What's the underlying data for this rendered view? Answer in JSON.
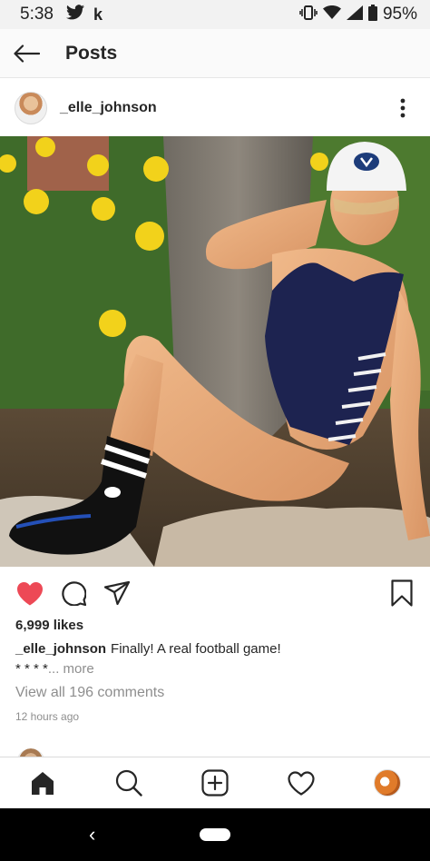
{
  "status_bar": {
    "time": "5:38",
    "left_icons": [
      "twitter-icon",
      "k-icon"
    ],
    "k_label": "k",
    "right_icons": [
      "vibrate-icon",
      "wifi-icon",
      "signal-icon",
      "battery-icon"
    ],
    "battery": "95%"
  },
  "top_bar": {
    "title": "Posts"
  },
  "post": {
    "username": "_elle_johnson",
    "likes": "6,999 likes",
    "caption_user": "_elle_johnson",
    "caption_text": "Finally! A real football game!",
    "caption_line2": "* * * *",
    "more_label": "... more",
    "view_comments": "View all 196 comments",
    "time_ago": "12 hours ago",
    "liked": true
  },
  "bottom_nav": [
    "home-icon",
    "search-icon",
    "add-icon",
    "heart-icon",
    "profile-avatar"
  ],
  "colors": {
    "like_red": "#ed4956",
    "text": "#262626",
    "muted": "#8e8e8e"
  }
}
